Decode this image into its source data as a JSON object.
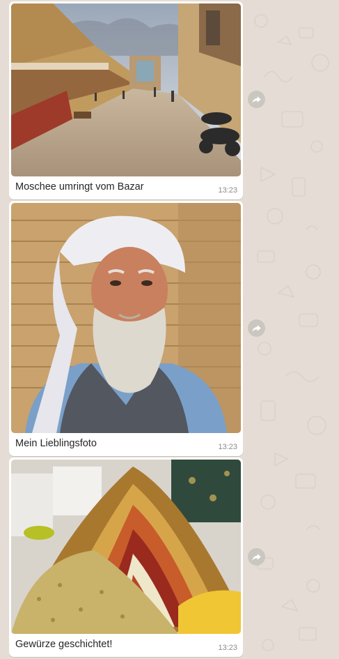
{
  "chat": {
    "messages": [
      {
        "caption": "Moschee umringt vom Bazar",
        "time": "13:23",
        "image": "bazaar-street-mosque"
      },
      {
        "caption": "Mein Lieblingsfoto",
        "time": "13:23",
        "image": "old-man-white-turban"
      },
      {
        "caption": "Gewürze geschichtet!",
        "time": "13:23",
        "image": "layered-spices-mound"
      }
    ],
    "forward_icon": "forward-arrow-icon"
  },
  "colors": {
    "wallpaper": "#e5ddd5",
    "bubble": "#ffffff",
    "time_text": "#8a8a8a",
    "caption_text": "#262626"
  }
}
